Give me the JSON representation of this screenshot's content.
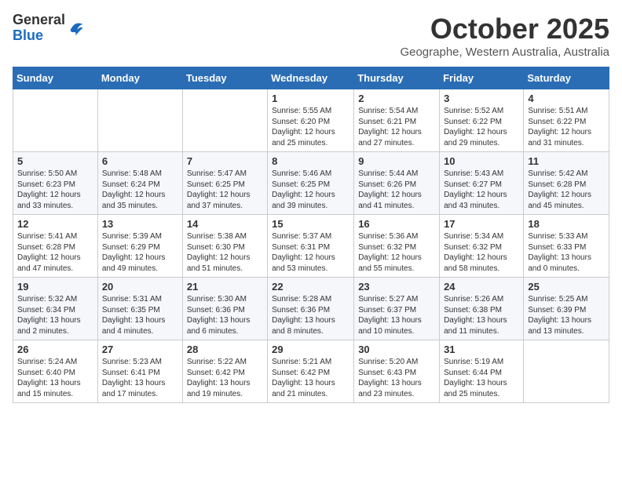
{
  "header": {
    "logo_general": "General",
    "logo_blue": "Blue",
    "month": "October 2025",
    "location": "Geographe, Western Australia, Australia"
  },
  "weekdays": [
    "Sunday",
    "Monday",
    "Tuesday",
    "Wednesday",
    "Thursday",
    "Friday",
    "Saturday"
  ],
  "weeks": [
    [
      {
        "day": "",
        "content": ""
      },
      {
        "day": "",
        "content": ""
      },
      {
        "day": "",
        "content": ""
      },
      {
        "day": "1",
        "content": "Sunrise: 5:55 AM\nSunset: 6:20 PM\nDaylight: 12 hours\nand 25 minutes."
      },
      {
        "day": "2",
        "content": "Sunrise: 5:54 AM\nSunset: 6:21 PM\nDaylight: 12 hours\nand 27 minutes."
      },
      {
        "day": "3",
        "content": "Sunrise: 5:52 AM\nSunset: 6:22 PM\nDaylight: 12 hours\nand 29 minutes."
      },
      {
        "day": "4",
        "content": "Sunrise: 5:51 AM\nSunset: 6:22 PM\nDaylight: 12 hours\nand 31 minutes."
      }
    ],
    [
      {
        "day": "5",
        "content": "Sunrise: 5:50 AM\nSunset: 6:23 PM\nDaylight: 12 hours\nand 33 minutes."
      },
      {
        "day": "6",
        "content": "Sunrise: 5:48 AM\nSunset: 6:24 PM\nDaylight: 12 hours\nand 35 minutes."
      },
      {
        "day": "7",
        "content": "Sunrise: 5:47 AM\nSunset: 6:25 PM\nDaylight: 12 hours\nand 37 minutes."
      },
      {
        "day": "8",
        "content": "Sunrise: 5:46 AM\nSunset: 6:25 PM\nDaylight: 12 hours\nand 39 minutes."
      },
      {
        "day": "9",
        "content": "Sunrise: 5:44 AM\nSunset: 6:26 PM\nDaylight: 12 hours\nand 41 minutes."
      },
      {
        "day": "10",
        "content": "Sunrise: 5:43 AM\nSunset: 6:27 PM\nDaylight: 12 hours\nand 43 minutes."
      },
      {
        "day": "11",
        "content": "Sunrise: 5:42 AM\nSunset: 6:28 PM\nDaylight: 12 hours\nand 45 minutes."
      }
    ],
    [
      {
        "day": "12",
        "content": "Sunrise: 5:41 AM\nSunset: 6:28 PM\nDaylight: 12 hours\nand 47 minutes."
      },
      {
        "day": "13",
        "content": "Sunrise: 5:39 AM\nSunset: 6:29 PM\nDaylight: 12 hours\nand 49 minutes."
      },
      {
        "day": "14",
        "content": "Sunrise: 5:38 AM\nSunset: 6:30 PM\nDaylight: 12 hours\nand 51 minutes."
      },
      {
        "day": "15",
        "content": "Sunrise: 5:37 AM\nSunset: 6:31 PM\nDaylight: 12 hours\nand 53 minutes."
      },
      {
        "day": "16",
        "content": "Sunrise: 5:36 AM\nSunset: 6:32 PM\nDaylight: 12 hours\nand 55 minutes."
      },
      {
        "day": "17",
        "content": "Sunrise: 5:34 AM\nSunset: 6:32 PM\nDaylight: 12 hours\nand 58 minutes."
      },
      {
        "day": "18",
        "content": "Sunrise: 5:33 AM\nSunset: 6:33 PM\nDaylight: 13 hours\nand 0 minutes."
      }
    ],
    [
      {
        "day": "19",
        "content": "Sunrise: 5:32 AM\nSunset: 6:34 PM\nDaylight: 13 hours\nand 2 minutes."
      },
      {
        "day": "20",
        "content": "Sunrise: 5:31 AM\nSunset: 6:35 PM\nDaylight: 13 hours\nand 4 minutes."
      },
      {
        "day": "21",
        "content": "Sunrise: 5:30 AM\nSunset: 6:36 PM\nDaylight: 13 hours\nand 6 minutes."
      },
      {
        "day": "22",
        "content": "Sunrise: 5:28 AM\nSunset: 6:36 PM\nDaylight: 13 hours\nand 8 minutes."
      },
      {
        "day": "23",
        "content": "Sunrise: 5:27 AM\nSunset: 6:37 PM\nDaylight: 13 hours\nand 10 minutes."
      },
      {
        "day": "24",
        "content": "Sunrise: 5:26 AM\nSunset: 6:38 PM\nDaylight: 13 hours\nand 11 minutes."
      },
      {
        "day": "25",
        "content": "Sunrise: 5:25 AM\nSunset: 6:39 PM\nDaylight: 13 hours\nand 13 minutes."
      }
    ],
    [
      {
        "day": "26",
        "content": "Sunrise: 5:24 AM\nSunset: 6:40 PM\nDaylight: 13 hours\nand 15 minutes."
      },
      {
        "day": "27",
        "content": "Sunrise: 5:23 AM\nSunset: 6:41 PM\nDaylight: 13 hours\nand 17 minutes."
      },
      {
        "day": "28",
        "content": "Sunrise: 5:22 AM\nSunset: 6:42 PM\nDaylight: 13 hours\nand 19 minutes."
      },
      {
        "day": "29",
        "content": "Sunrise: 5:21 AM\nSunset: 6:42 PM\nDaylight: 13 hours\nand 21 minutes."
      },
      {
        "day": "30",
        "content": "Sunrise: 5:20 AM\nSunset: 6:43 PM\nDaylight: 13 hours\nand 23 minutes."
      },
      {
        "day": "31",
        "content": "Sunrise: 5:19 AM\nSunset: 6:44 PM\nDaylight: 13 hours\nand 25 minutes."
      },
      {
        "day": "",
        "content": ""
      }
    ]
  ]
}
